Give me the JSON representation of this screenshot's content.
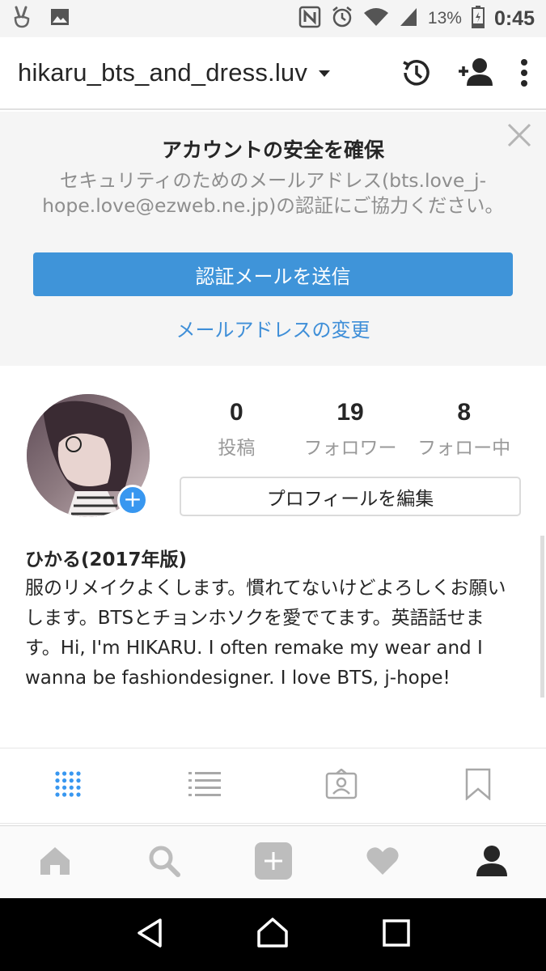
{
  "status_bar": {
    "battery": "13%",
    "time": "0:45",
    "icons": [
      "peace-hand-icon",
      "image-icon",
      "nfc-icon",
      "alarm-icon",
      "wifi-icon",
      "signal-icon",
      "battery-icon"
    ]
  },
  "header": {
    "username": "hikaru_bts_and_dress.luv",
    "icons": [
      "chevron-down-icon",
      "history-icon",
      "add-person-icon",
      "more-vert-icon"
    ]
  },
  "security_banner": {
    "title": "アカウントの安全を確保",
    "description": "セキュリティのためのメールアドレス(bts.love_j-hope.love@ezweb.ne.jp)の認証にご協力ください。",
    "button_label": "認証メールを送信",
    "link_label": "メールアドレスの変更",
    "button_color": "#3f94d9",
    "link_color": "#3f8fd8"
  },
  "profile": {
    "stats": [
      {
        "value": "0",
        "label": "投稿"
      },
      {
        "value": "19",
        "label": "フォロワー"
      },
      {
        "value": "8",
        "label": "フォロー中"
      }
    ],
    "edit_label": "プロフィールを編集",
    "name": "ひかる(2017年版)",
    "bio": "服のリメイクよくします。慣れてないけどよろしくお願いします。BTSとチョンホソクを愛でてます。英語話せます。Hi, I'm HIKARU. I often remake my wear and I wanna be fashiondesigner. I love BTS, j-hope!"
  },
  "profile_tabs": [
    "grid-icon",
    "list-icon",
    "tagged-icon",
    "bookmark-icon"
  ],
  "bottom_nav": [
    "home-icon",
    "search-icon",
    "add-post-icon",
    "heart-icon",
    "profile-icon"
  ],
  "android_nav": [
    "back-icon",
    "home-circle-icon",
    "recents-icon"
  ],
  "colors": {
    "accent": "#3897f0",
    "muted": "#999999"
  }
}
